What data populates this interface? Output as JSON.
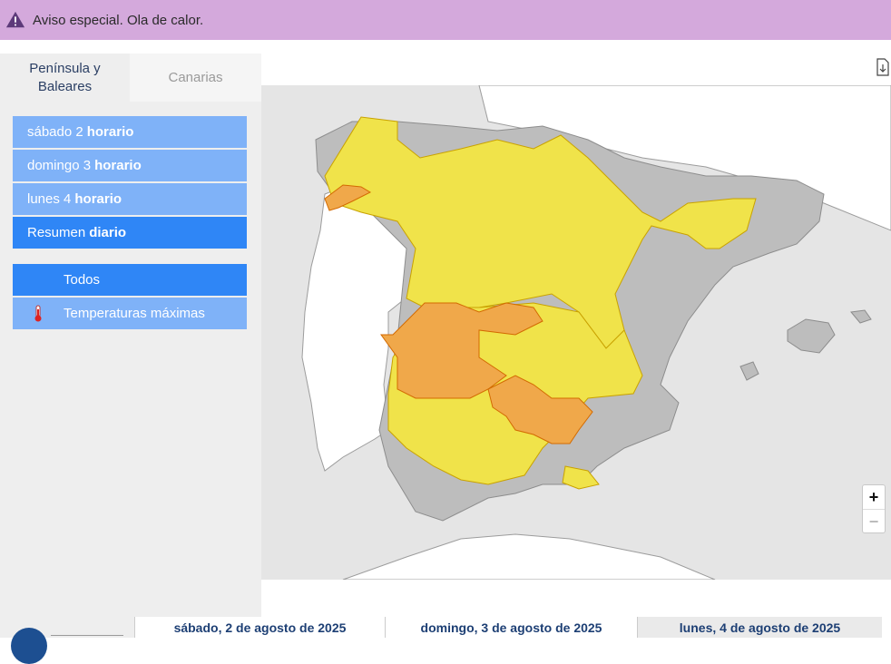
{
  "banner": {
    "text": "Aviso especial. Ola de calor.",
    "color": "#d4a9dc"
  },
  "tabs": [
    {
      "label": "Península y Baleares",
      "active": true
    },
    {
      "label": "Canarias",
      "active": false
    }
  ],
  "days": [
    {
      "prefix": "sábado 2",
      "bold": "horario",
      "selected": false
    },
    {
      "prefix": "domingo 3",
      "bold": "horario",
      "selected": false
    },
    {
      "prefix": "lunes 4",
      "bold": "horario",
      "selected": false
    },
    {
      "prefix": "Resumen",
      "bold": "diario",
      "selected": true
    }
  ],
  "filters": [
    {
      "label": "Todos",
      "icon": "",
      "selected": true
    },
    {
      "label": "Temperaturas máximas",
      "icon": "thermometer-icon",
      "selected": false
    }
  ],
  "map": {
    "colors": {
      "sea": "#e5e5e5",
      "land": "#bdbdbd",
      "yellow": "#f0e34a",
      "orange": "#f0a84a"
    },
    "logo": "aemet"
  },
  "zoom": {
    "in": "+",
    "out": "−"
  },
  "timeline": {
    "dates": [
      "sábado, 2 de agosto de 2025",
      "domingo, 3 de agosto de 2025",
      "lunes, 4 de agosto de 2025"
    ]
  }
}
